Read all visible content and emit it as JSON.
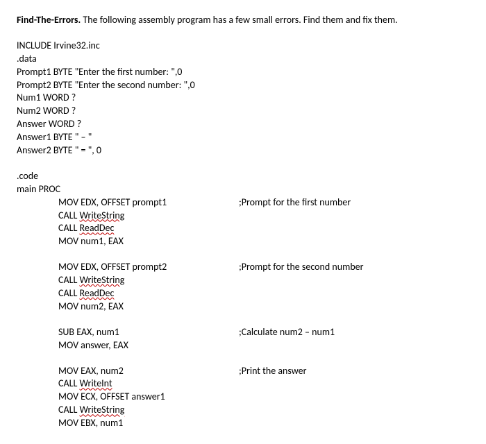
{
  "title_bold": "Find-The-Errors.",
  "title_rest": " The following assembly program has a few small errors. Find them and fix them.",
  "header": {
    "lines": [
      "INCLUDE Irvine32.inc",
      ".data",
      "Prompt1 BYTE \"Enter the first number: \",0",
      "Prompt2 BYTE \"Enter the second number: \",0",
      "Num1 WORD ?",
      "Num2 WORD ?",
      "Answer WORD ?",
      "Answer1 BYTE \" – \"",
      "Answer2 BYTE \" = \", 0"
    ]
  },
  "code_label": ".code",
  "main_label": "main PROC",
  "b1": {
    "l1": {
      "instr": "MOV EDX, OFFSET prompt1",
      "comment": ";Prompt for the first number"
    },
    "l2a": "CALL ",
    "l2b": "WriteString",
    "l3a": "CALL ",
    "l3b": "ReadDec",
    "l4": "MOV num1, EAX"
  },
  "b2": {
    "l1": {
      "instr": "MOV EDX, OFFSET prompt2",
      "comment": ";Prompt for the second number"
    },
    "l2a": "CALL ",
    "l2b": "WriteString",
    "l3a": "CALL ",
    "l3b": "ReadDec",
    "l4": "MOV num2, EAX"
  },
  "b3": {
    "l1": {
      "instr": "SUB EAX, num1",
      "comment": ";Calculate num2 – num1"
    },
    "l2": "MOV answer, EAX"
  },
  "b4": {
    "l1": {
      "instr": "MOV EAX, num2",
      "comment": ";Print the answer"
    },
    "l2a": "CALL ",
    "l2b": "WriteInt",
    "l3": "MOV ECX, OFFSET answer1",
    "l4a": "CALL ",
    "l4b": "WriteString",
    "l5": "MOV EBX, num1"
  }
}
